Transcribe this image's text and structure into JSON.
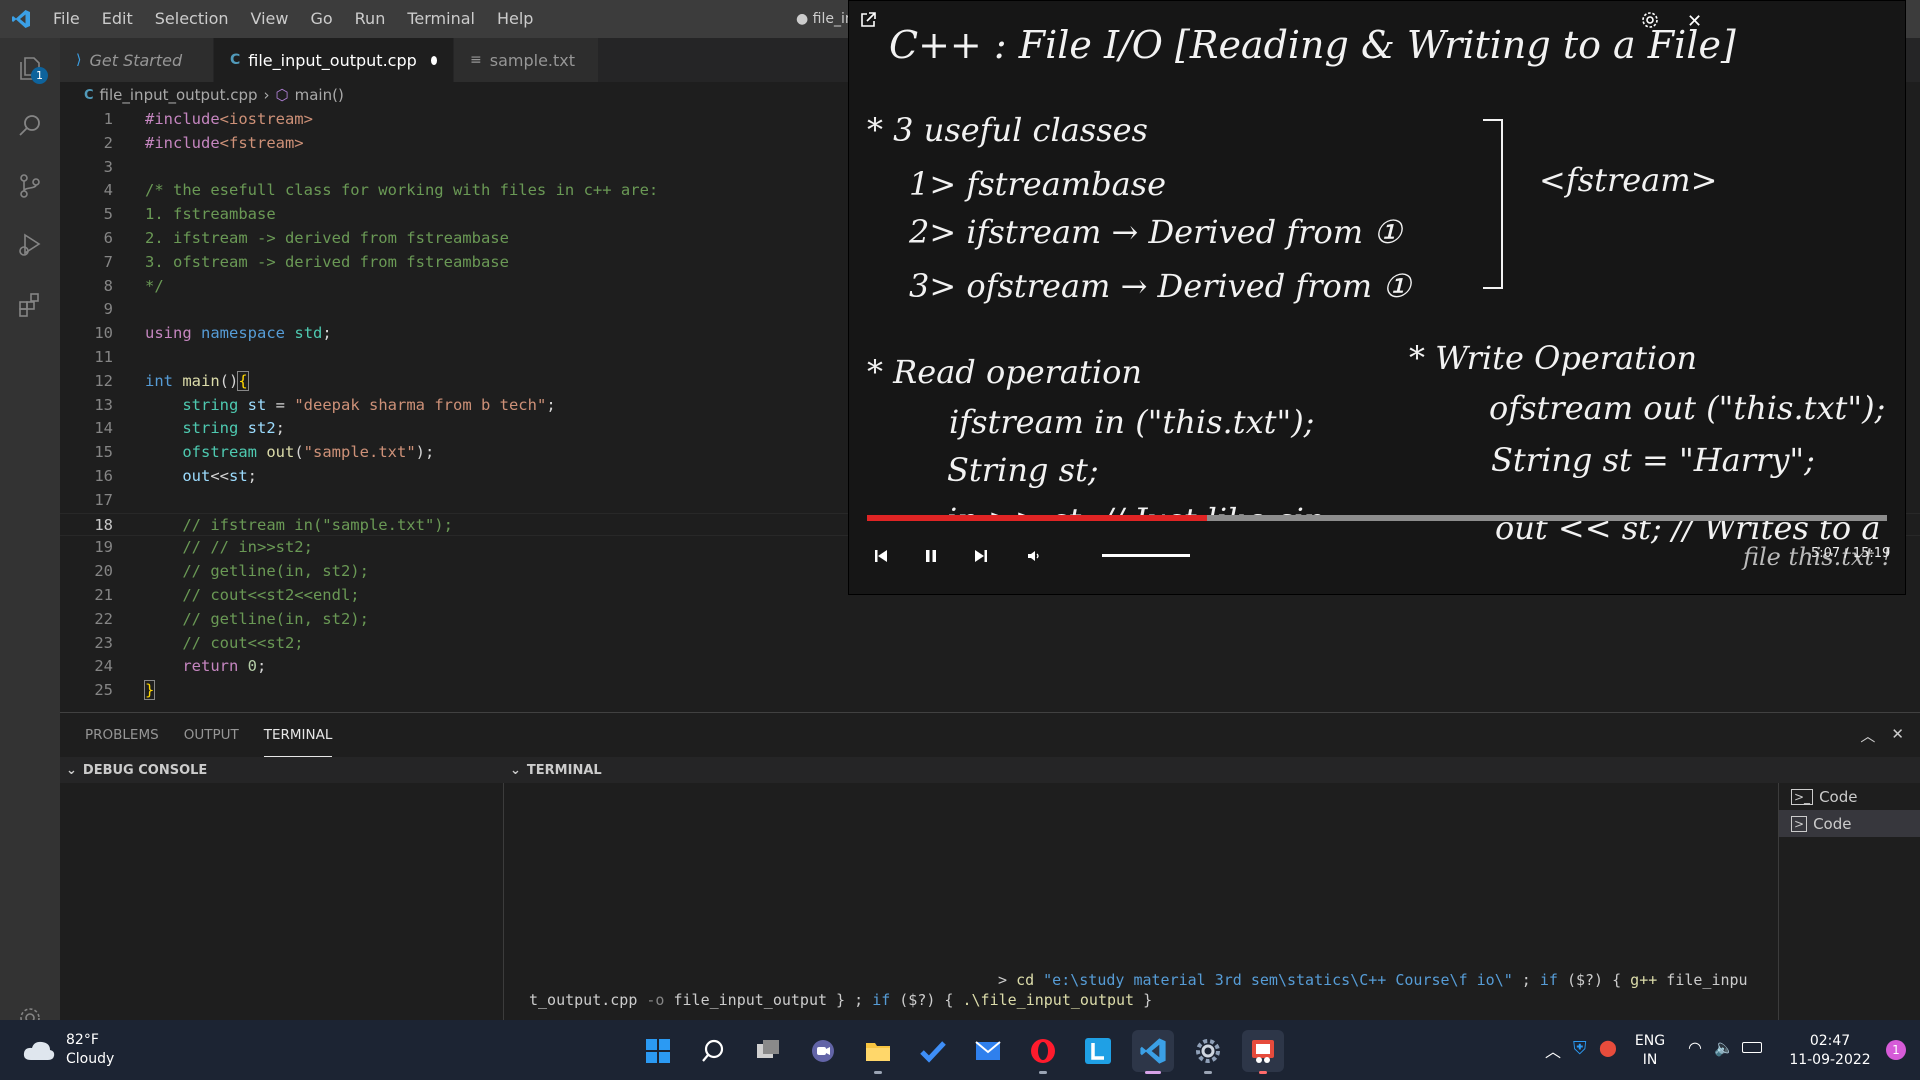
{
  "menu": [
    "File",
    "Edit",
    "Selection",
    "View",
    "Go",
    "Run",
    "Terminal",
    "Help"
  ],
  "window_title": "● file_in",
  "activity": {
    "files_badge": "1"
  },
  "tabs": [
    {
      "label": "Get Started",
      "icon": "vscode-icon"
    },
    {
      "label": "file_input_output.cpp",
      "icon": "cpp-file-icon"
    },
    {
      "label": "sample.txt",
      "icon": "text-file-icon"
    }
  ],
  "breadcrumb": {
    "file": "file_input_output.cpp",
    "symbol": "main()"
  },
  "editor": {
    "current_line": 18,
    "line_numbers": [
      "1",
      "2",
      "3",
      "4",
      "5",
      "6",
      "7",
      "8",
      "9",
      "10",
      "11",
      "12",
      "13",
      "14",
      "15",
      "16",
      "17",
      "18",
      "19",
      "20",
      "21",
      "22",
      "23",
      "24",
      "25"
    ],
    "l1": {
      "a": "#include",
      "b": "<iostream>"
    },
    "l2": {
      "a": "#include",
      "b": "<fstream>"
    },
    "l4": "/* the esefull class for working with files in c++ are:",
    "l5": "1. fstreambase",
    "l6": "2. ifstream -> derived from fstreambase",
    "l7": "3. ofstream -> derived from fstreambase",
    "l8": "*/",
    "l10": {
      "a": "using",
      "b": "namespace",
      "c": "std",
      "d": ";"
    },
    "l12": {
      "a": "int",
      "b": "main",
      "c": "()",
      "d": "{"
    },
    "l13": {
      "a": "string",
      "b": "st",
      "c": " = ",
      "d": "\"deepak sharma from b tech\"",
      "e": ";"
    },
    "l14": {
      "a": "string",
      "b": "st2",
      "c": ";"
    },
    "l15": {
      "a": "ofstream",
      "b": "out",
      "c": "(",
      "d": "\"sample.txt\"",
      "e": ");"
    },
    "l16": {
      "a": "out",
      "b": "<<",
      "c": "st",
      "d": ";"
    },
    "l18": "// ifstream in(\"sample.txt\");",
    "l19": "// // in>>st2;",
    "l20": "// getline(in, st2);",
    "l21": "// cout<<st2<<endl;",
    "l22": "// getline(in, st2);",
    "l23": "// cout<<st2;",
    "l24": {
      "a": "return",
      "b": "0",
      "c": ";"
    },
    "l25": "}"
  },
  "video": {
    "title": "C++ : File I/O [Reading & Writing to a File]",
    "classes_heading": "* 3 useful classes",
    "c1": "1> fstreambase",
    "c2": "2> ifstream → Derived from ①",
    "c3": "3> ofstream → Derived from ①",
    "header_tag": "<fstream>",
    "read_heading": "* Read operation",
    "read_1": "ifstream in (\"this.txt\");",
    "read_2": "String st;",
    "read_3": "in >> st; // Just like cin",
    "write_heading": "* Write Operation",
    "write_1": "ofstream out (\"this.txt\");",
    "write_2": "String st = \"Harry\";",
    "write_3": "out << st; // Writes to a",
    "write_4": "file this.txt !",
    "time": "5:07 / 15:19",
    "progress": 0.333
  },
  "panel": {
    "tabs": [
      "PROBLEMS",
      "OUTPUT",
      "TERMINAL"
    ],
    "debug_console": "DEBUG CONSOLE",
    "terminal": "TERMINAL",
    "terminals": [
      "Code",
      "Code"
    ],
    "cmd": {
      "p1": "> ",
      "p2": "cd ",
      "p3": "\"e:\\study material 3rd sem\\statics\\C++ Course\\f io\\\"",
      "p4": " ; ",
      "p5": "if ",
      "p6": "($?)",
      "p7": " { ",
      "p8": "g++ ",
      "p9": "file_inpu",
      "q1": "t_output.cpp ",
      "q2": "-o ",
      "q3": "file_input_output } ; ",
      "q4": "if ",
      "q5": "($?)",
      "q6": " { ",
      "q7": ".\\file_input_output",
      "q8": " }"
    }
  },
  "taskbar": {
    "temp": "82°F",
    "weather": "Cloudy",
    "lang1": "ENG",
    "lang2": "IN",
    "time": "02:47",
    "date": "11-09-2022",
    "notif": "1"
  },
  "colors": {
    "accent": "#007acc",
    "editor_bg": "#1e1e1e",
    "taskbar_bg": "#1c2433",
    "progress": "#e02424"
  }
}
